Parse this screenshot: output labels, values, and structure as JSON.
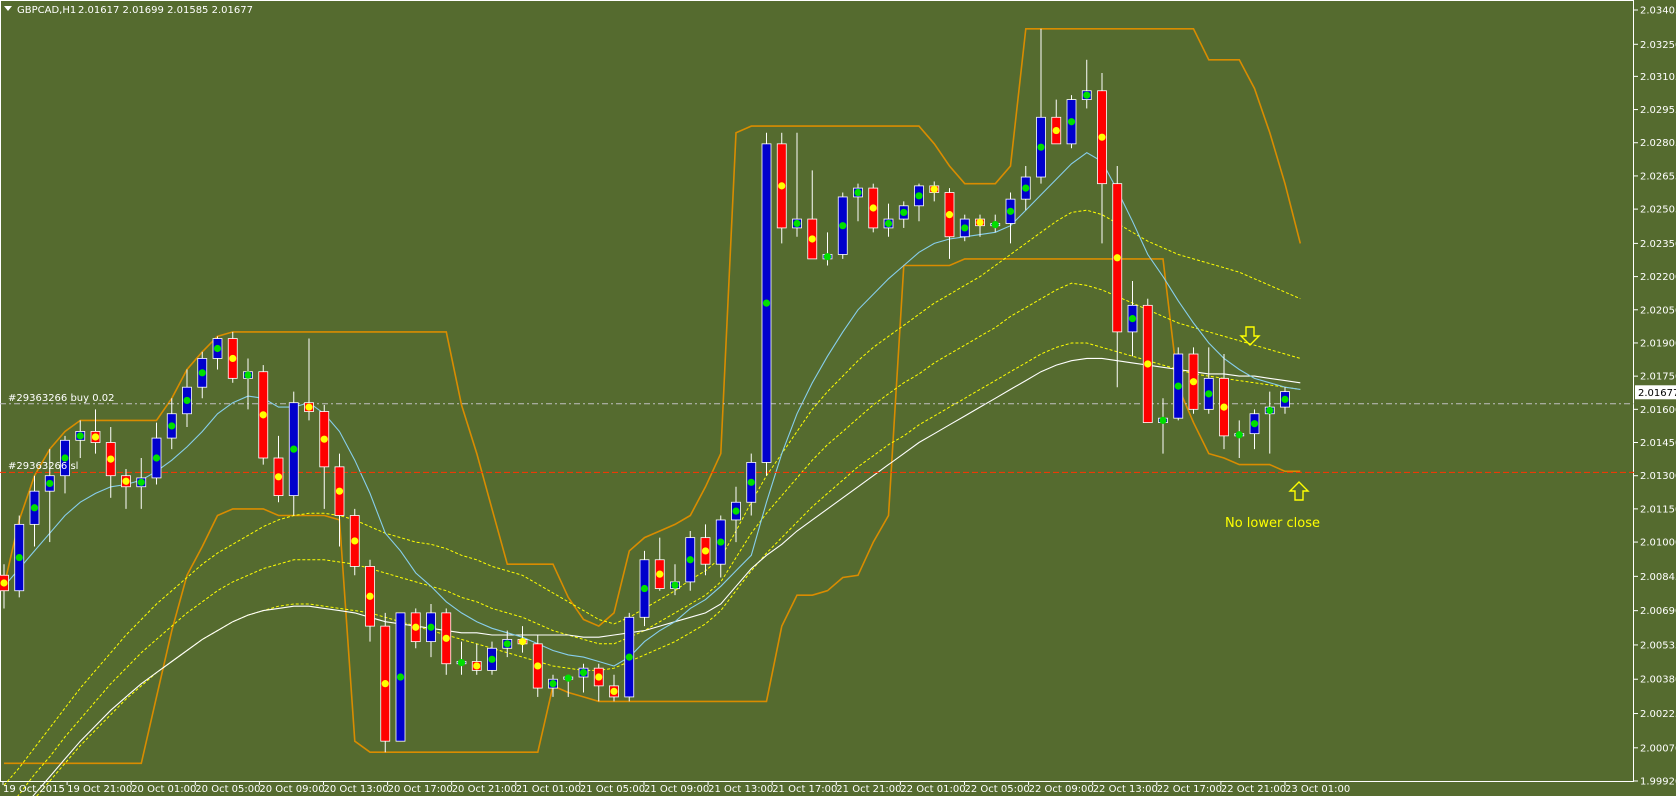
{
  "header": {
    "symbol_label": "GBPCAD,H1",
    "ohlc_label": "2.01617 2.01699 2.01585 2.01677"
  },
  "orders": {
    "buy_label": "#29363266 buy 0.02",
    "sl_label": "#29363266 sl"
  },
  "annotations": {
    "no_lower_close": "No lower close"
  },
  "price_tag": "2.01677",
  "colors": {
    "background": "#556B2F",
    "bull_body": "#0000CC",
    "bear_body": "#FF0000",
    "wick": "#FFFFFF",
    "channel": "#D98C00",
    "ma_fast": "#87CEEB",
    "ma_slow": "#FFFFFF",
    "ma_dashed": "#FFFF00",
    "dot_green": "#00E000",
    "dot_yellow": "#FFFF00",
    "order_line": "#C0C0C0",
    "sl_line": "#FF3300",
    "arrows": "#FFFF00"
  },
  "chart_data": {
    "type": "candlestick",
    "ylim": [
      1.9992,
      2.03405
    ],
    "y_ticks": [
      "2.03405",
      "2.03250",
      "2.03105",
      "2.02955",
      "2.02805",
      "2.02655",
      "2.02505",
      "2.02350",
      "2.02200",
      "2.02050",
      "2.01900",
      "2.01750",
      "2.01600",
      "2.01450",
      "2.01300",
      "2.01150",
      "2.01000",
      "2.00845",
      "2.00690",
      "2.00535",
      "2.00380",
      "2.00225",
      "2.00070",
      "1.99920"
    ],
    "x_ticks": [
      "19 Oct 2015",
      "19 Oct 21:00",
      "20 Oct 01:00",
      "20 Oct 05:00",
      "20 Oct 09:00",
      "20 Oct 13:00",
      "20 Oct 17:00",
      "20 Oct 21:00",
      "21 Oct 01:00",
      "21 Oct 05:00",
      "21 Oct 09:00",
      "21 Oct 13:00",
      "21 Oct 17:00",
      "21 Oct 21:00",
      "22 Oct 01:00",
      "22 Oct 05:00",
      "22 Oct 09:00",
      "22 Oct 13:00",
      "22 Oct 17:00",
      "22 Oct 21:00",
      "23 Oct 01:00"
    ],
    "order_price": 2.01625,
    "sl_price": 2.01315,
    "current_price": 2.01677,
    "candles": [
      [
        2.0085,
        2.009,
        2.007,
        2.0078
      ],
      [
        2.0078,
        2.0112,
        2.0075,
        2.0108
      ],
      [
        2.0108,
        2.013,
        2.0098,
        2.0123
      ],
      [
        2.0123,
        2.0142,
        2.01,
        2.013
      ],
      [
        2.013,
        2.0148,
        2.0122,
        2.0146
      ],
      [
        2.0146,
        2.0155,
        2.0138,
        2.015
      ],
      [
        2.015,
        2.016,
        2.014,
        2.0145
      ],
      [
        2.0145,
        2.0152,
        2.012,
        2.013
      ],
      [
        2.013,
        2.0133,
        2.0115,
        2.0125
      ],
      [
        2.0125,
        2.0138,
        2.0115,
        2.0129
      ],
      [
        2.0129,
        2.0154,
        2.0126,
        2.0147
      ],
      [
        2.0147,
        2.0165,
        2.0142,
        2.0158
      ],
      [
        2.0158,
        2.0178,
        2.0152,
        2.017
      ],
      [
        2.017,
        2.0186,
        2.0165,
        2.0183
      ],
      [
        2.0183,
        2.0193,
        2.0178,
        2.0192
      ],
      [
        2.0192,
        2.0195,
        2.0172,
        2.0174
      ],
      [
        2.0174,
        2.0183,
        2.016,
        2.0177
      ],
      [
        2.0177,
        2.018,
        2.0135,
        2.0138
      ],
      [
        2.0138,
        2.0148,
        2.0118,
        2.0121
      ],
      [
        2.0121,
        2.0168,
        2.0112,
        2.0163
      ],
      [
        2.0163,
        2.0192,
        2.0155,
        2.0159
      ],
      [
        2.0159,
        2.0162,
        2.0115,
        2.0134
      ],
      [
        2.0134,
        2.014,
        2.0098,
        2.0112
      ],
      [
        2.0112,
        2.0115,
        2.0085,
        2.0089
      ],
      [
        2.0089,
        2.0092,
        2.0055,
        2.0062
      ],
      [
        2.0062,
        2.0068,
        2.0005,
        2.001
      ],
      [
        2.001,
        2.0068,
        2.001,
        2.0068
      ],
      [
        2.0068,
        2.007,
        2.0052,
        2.0055
      ],
      [
        2.0055,
        2.0072,
        2.0048,
        2.0068
      ],
      [
        2.0068,
        2.007,
        2.004,
        2.0045
      ],
      [
        2.0045,
        2.0055,
        2.004,
        2.0046
      ],
      [
        2.0046,
        2.0054,
        2.004,
        2.0042
      ],
      [
        2.0042,
        2.0055,
        2.004,
        2.0052
      ],
      [
        2.0052,
        2.006,
        2.0048,
        2.0056
      ],
      [
        2.0056,
        2.0062,
        2.005,
        2.0054
      ],
      [
        2.0054,
        2.0058,
        2.003,
        2.0034
      ],
      [
        2.0034,
        2.004,
        2.003,
        2.0038
      ],
      [
        2.0038,
        2.004,
        2.003,
        2.0039
      ],
      [
        2.0039,
        2.0045,
        2.0032,
        2.0043
      ],
      [
        2.0043,
        2.0045,
        2.0028,
        2.0035
      ],
      [
        2.0035,
        2.004,
        2.0028,
        2.003
      ],
      [
        2.003,
        2.0068,
        2.0028,
        2.0066
      ],
      [
        2.0066,
        2.0096,
        2.0062,
        2.0092
      ],
      [
        2.0092,
        2.0102,
        2.0078,
        2.0079
      ],
      [
        2.0079,
        2.009,
        2.0076,
        2.0082
      ],
      [
        2.0082,
        2.0105,
        2.0078,
        2.0102
      ],
      [
        2.0102,
        2.0108,
        2.0085,
        2.009
      ],
      [
        2.009,
        2.0112,
        2.0084,
        2.011
      ],
      [
        2.011,
        2.0125,
        2.01,
        2.0118
      ],
      [
        2.0118,
        2.014,
        2.0112,
        2.0136
      ],
      [
        2.0136,
        2.0285,
        2.013,
        2.028
      ],
      [
        2.028,
        2.0285,
        2.0235,
        2.0242
      ],
      [
        2.0242,
        2.0285,
        2.0238,
        2.0246
      ],
      [
        2.0246,
        2.0268,
        2.0232,
        2.0228
      ],
      [
        2.0228,
        2.024,
        2.0225,
        2.023
      ],
      [
        2.023,
        2.0258,
        2.0228,
        2.0256
      ],
      [
        2.0256,
        2.0262,
        2.0245,
        2.026
      ],
      [
        2.026,
        2.0262,
        2.024,
        2.0242
      ],
      [
        2.0242,
        2.0253,
        2.0238,
        2.0246
      ],
      [
        2.0246,
        2.0254,
        2.0242,
        2.0252
      ],
      [
        2.0252,
        2.0262,
        2.0245,
        2.0261
      ],
      [
        2.0261,
        2.0263,
        2.0254,
        2.0258
      ],
      [
        2.0258,
        2.026,
        2.0228,
        2.0238
      ],
      [
        2.0238,
        2.0248,
        2.0236,
        2.0246
      ],
      [
        2.0246,
        2.0248,
        2.0238,
        2.0243
      ],
      [
        2.0243,
        2.0248,
        2.024,
        2.0244
      ],
      [
        2.0244,
        2.0258,
        2.0235,
        2.0255
      ],
      [
        2.0255,
        2.027,
        2.025,
        2.0265
      ],
      [
        2.0265,
        2.0332,
        2.0262,
        2.0292
      ],
      [
        2.0292,
        2.03,
        2.0282,
        2.028
      ],
      [
        2.028,
        2.0302,
        2.0278,
        2.03
      ],
      [
        2.03,
        2.0318,
        2.0296,
        2.0304
      ],
      [
        2.0304,
        2.0312,
        2.0235,
        2.0262
      ],
      [
        2.0262,
        2.027,
        2.017,
        2.0195
      ],
      [
        2.0195,
        2.0218,
        2.0184,
        2.0207
      ],
      [
        2.0207,
        2.021,
        2.0154,
        2.0154
      ],
      [
        2.0154,
        2.0165,
        2.014,
        2.0156
      ],
      [
        2.0156,
        2.0188,
        2.0155,
        2.0185
      ],
      [
        2.0185,
        2.0188,
        2.0158,
        2.016
      ],
      [
        2.016,
        2.0188,
        2.0158,
        2.0174
      ],
      [
        2.0174,
        2.0185,
        2.0142,
        2.0148
      ],
      [
        2.0148,
        2.0155,
        2.0138,
        2.0149
      ],
      [
        2.0149,
        2.016,
        2.0142,
        2.0158
      ],
      [
        2.0158,
        2.0168,
        2.014,
        2.0161
      ],
      [
        2.0161,
        2.017,
        2.0158,
        2.0168
      ]
    ],
    "series": [
      {
        "name": "channel_upper",
        "values": [
          2.008,
          2.011,
          2.013,
          2.0142,
          2.015,
          2.0155,
          2.0155,
          2.0155,
          2.0155,
          2.0155,
          2.0155,
          2.0165,
          2.0178,
          2.0186,
          2.0193,
          2.0195,
          2.0195,
          2.0195,
          2.0195,
          2.0195,
          2.0195,
          2.0195,
          2.0195,
          2.0195,
          2.0195,
          2.0195,
          2.0195,
          2.0195,
          2.0195,
          2.0195,
          2.0162,
          2.014,
          2.0115,
          2.009,
          2.009,
          2.009,
          2.009,
          2.0075,
          2.0065,
          2.0062,
          2.0068,
          2.0096,
          2.0102,
          2.0105,
          2.0108,
          2.0112,
          2.0125,
          2.014,
          2.0285,
          2.0288,
          2.0288,
          2.0288,
          2.0288,
          2.0288,
          2.0288,
          2.0288,
          2.0288,
          2.0288,
          2.0288,
          2.0288,
          2.0288,
          2.028,
          2.027,
          2.0262,
          2.0262,
          2.0262,
          2.027,
          2.0332,
          2.0332,
          2.0332,
          2.0332,
          2.0332,
          2.0332,
          2.0332,
          2.0332,
          2.0332,
          2.0332,
          2.0332,
          2.0332,
          2.0318,
          2.0318,
          2.0318,
          2.0305,
          2.0285,
          2.0262,
          2.0235
        ]
      },
      {
        "name": "channel_lower",
        "values": [
          2.0,
          2.0,
          2.0,
          2.0,
          2.0,
          2.0,
          2.0,
          2.0,
          2.0,
          2.0,
          2.003,
          2.006,
          2.0085,
          2.0098,
          2.0112,
          2.0115,
          2.0115,
          2.0115,
          2.0112,
          2.0112,
          2.0112,
          2.0112,
          2.011,
          2.001,
          2.0005,
          2.0005,
          2.0005,
          2.0005,
          2.0005,
          2.0005,
          2.0005,
          2.0005,
          2.0005,
          2.0005,
          2.0005,
          2.0005,
          2.0035,
          2.0032,
          2.003,
          2.0028,
          2.0028,
          2.0028,
          2.0028,
          2.0028,
          2.0028,
          2.0028,
          2.0028,
          2.0028,
          2.0028,
          2.0028,
          2.0028,
          2.0062,
          2.0076,
          2.0076,
          2.0078,
          2.0084,
          2.0085,
          2.01,
          2.0112,
          2.0225,
          2.0225,
          2.0225,
          2.0225,
          2.0228,
          2.0228,
          2.0228,
          2.0228,
          2.0228,
          2.0228,
          2.0228,
          2.0228,
          2.0228,
          2.0228,
          2.0228,
          2.0228,
          2.0228,
          2.0228,
          2.017,
          2.0154,
          2.014,
          2.0138,
          2.0135,
          2.0135,
          2.0135,
          2.0132,
          2.0132
        ]
      },
      {
        "name": "ma_fast",
        "values": [
          2.008,
          2.0088,
          2.0096,
          2.0104,
          2.0112,
          2.0118,
          2.0122,
          2.0125,
          2.0126,
          2.0128,
          2.0132,
          2.0137,
          2.0143,
          2.015,
          2.0158,
          2.0163,
          2.0166,
          2.0165,
          2.0161,
          2.0161,
          2.0163,
          2.0158,
          2.015,
          2.0137,
          2.0122,
          2.0104,
          2.0096,
          2.0086,
          2.008,
          2.0073,
          2.0068,
          2.0064,
          2.0061,
          2.0059,
          2.0057,
          2.0054,
          2.0051,
          2.0049,
          2.0048,
          2.0046,
          2.0044,
          2.0048,
          2.0055,
          2.006,
          2.0064,
          2.007,
          2.0074,
          2.008,
          2.0087,
          2.0094,
          2.0118,
          2.014,
          2.0158,
          2.0172,
          2.0184,
          2.0195,
          2.0205,
          2.0212,
          2.0219,
          2.0225,
          2.0231,
          2.0235,
          2.0237,
          2.0238,
          2.0239,
          2.024,
          2.0243,
          2.025,
          2.0257,
          2.0264,
          2.0271,
          2.0276,
          2.0272,
          2.0259,
          2.0245,
          2.023,
          2.022,
          2.0209,
          2.0199,
          2.019,
          2.0183,
          2.0178,
          2.0174,
          2.0172,
          2.017,
          2.0169
        ]
      },
      {
        "name": "ma_slow",
        "values": [
          1.997,
          1.9978,
          1.9986,
          1.9994,
          2.0002,
          2.001,
          2.0017,
          2.0024,
          2.003,
          2.0036,
          2.0041,
          2.0046,
          2.0051,
          2.0056,
          2.006,
          2.0064,
          2.0067,
          2.0069,
          2.007,
          2.0071,
          2.0071,
          2.007,
          2.0069,
          2.0068,
          2.0066,
          2.0064,
          2.0063,
          2.0062,
          2.0061,
          2.006,
          2.0059,
          2.0059,
          2.0058,
          2.0058,
          2.0058,
          2.0058,
          2.0058,
          2.0058,
          2.0057,
          2.0057,
          2.0058,
          2.0059,
          2.006,
          2.0062,
          2.0064,
          2.0066,
          2.0068,
          2.0072,
          2.008,
          2.0088,
          2.0094,
          2.0099,
          2.0105,
          2.011,
          2.0115,
          2.012,
          2.0125,
          2.013,
          2.0135,
          2.014,
          2.0145,
          2.0149,
          2.0153,
          2.0157,
          2.0161,
          2.0165,
          2.0169,
          2.0173,
          2.0177,
          2.018,
          2.0182,
          2.0183,
          2.0183,
          2.0182,
          2.0181,
          2.018,
          2.0179,
          2.0178,
          2.0177,
          2.0176,
          2.0176,
          2.0175,
          2.0175,
          2.0174,
          2.0173,
          2.0172
        ]
      },
      {
        "name": "ma_dashed_1",
        "values": [
          1.999,
          1.9998,
          2.0007,
          2.0016,
          2.0025,
          2.0034,
          2.0042,
          2.005,
          2.0058,
          2.0065,
          2.0072,
          2.0078,
          2.0084,
          2.009,
          2.0095,
          2.0099,
          2.0103,
          2.0107,
          2.011,
          2.0112,
          2.0113,
          2.0113,
          2.0112,
          2.011,
          2.0107,
          2.0104,
          2.0102,
          2.01,
          2.0099,
          2.0097,
          2.0094,
          2.0092,
          2.0089,
          2.0087,
          2.0085,
          2.0081,
          2.0077,
          2.0073,
          2.0069,
          2.0065,
          2.0063,
          2.0066,
          2.007,
          2.0074,
          2.0078,
          2.0083,
          2.0087,
          2.0093,
          2.0105,
          2.0118,
          2.013,
          2.014,
          2.015,
          2.016,
          2.0168,
          2.0175,
          2.0182,
          2.0188,
          2.0193,
          2.0198,
          2.0203,
          2.0208,
          2.0212,
          2.0216,
          2.022,
          2.0225,
          2.023,
          2.0235,
          2.024,
          2.0245,
          2.0249,
          2.025,
          2.0248,
          2.0244,
          2.024,
          2.0236,
          2.0233,
          2.023,
          2.0228,
          2.0226,
          2.0224,
          2.0222,
          2.0219,
          2.0216,
          2.0213,
          2.021
        ]
      },
      {
        "name": "ma_dashed_2",
        "values": [
          1.9978,
          1.9986,
          1.9995,
          2.0003,
          2.0012,
          2.002,
          2.0028,
          2.0036,
          2.0043,
          2.005,
          2.0056,
          2.0062,
          2.0068,
          2.0073,
          2.0078,
          2.0082,
          2.0085,
          2.0088,
          2.009,
          2.0092,
          2.0092,
          2.0092,
          2.0091,
          2.009,
          2.0088,
          2.0086,
          2.0084,
          2.0082,
          2.008,
          2.0078,
          2.0075,
          2.0073,
          2.007,
          2.0068,
          2.0066,
          2.0063,
          2.006,
          2.0058,
          2.0056,
          2.0054,
          2.0054,
          2.0057,
          2.006,
          2.0064,
          2.0068,
          2.0072,
          2.0076,
          2.0082,
          2.0093,
          2.0104,
          2.0113,
          2.0121,
          2.0129,
          2.0137,
          2.0144,
          2.015,
          2.0156,
          2.0162,
          2.0167,
          2.0172,
          2.0176,
          2.0181,
          2.0185,
          2.0189,
          2.0193,
          2.0197,
          2.0202,
          2.0206,
          2.021,
          2.0214,
          2.0217,
          2.0216,
          2.0214,
          2.0211,
          2.0208,
          2.0205,
          2.0202,
          2.0199,
          2.0197,
          2.0195,
          2.0193,
          2.0191,
          2.0189,
          2.0187,
          2.0185,
          2.0183
        ]
      },
      {
        "name": "ma_dashed_3",
        "values": [
          1.9968,
          1.9976,
          1.9984,
          1.9992,
          2.0,
          2.0008,
          2.0015,
          2.0022,
          2.0029,
          2.0035,
          2.0041,
          2.0046,
          2.0051,
          2.0056,
          2.006,
          2.0064,
          2.0067,
          2.0069,
          2.0071,
          2.0072,
          2.0072,
          2.0071,
          2.007,
          2.0069,
          2.0068,
          2.0066,
          2.0064,
          2.0062,
          2.006,
          2.0058,
          2.0056,
          2.0054,
          2.0052,
          2.005,
          2.0048,
          2.0046,
          2.0044,
          2.0043,
          2.0042,
          2.0042,
          2.0043,
          2.0046,
          2.0049,
          2.0052,
          2.0055,
          2.0059,
          2.0063,
          2.0069,
          2.0078,
          2.0087,
          2.0095,
          2.0102,
          2.0109,
          2.0116,
          2.0122,
          2.0128,
          2.0134,
          2.0139,
          2.0144,
          2.0148,
          2.0153,
          2.0157,
          2.0161,
          2.0165,
          2.0169,
          2.0173,
          2.0177,
          2.0181,
          2.0185,
          2.0188,
          2.019,
          2.019,
          2.0188,
          2.0186,
          2.0184,
          2.0182,
          2.018,
          2.0178,
          2.0176,
          2.0175,
          2.0174,
          2.0173,
          2.0172,
          2.0171,
          2.017,
          2.0169
        ]
      }
    ],
    "grid": false,
    "legend": "none"
  }
}
